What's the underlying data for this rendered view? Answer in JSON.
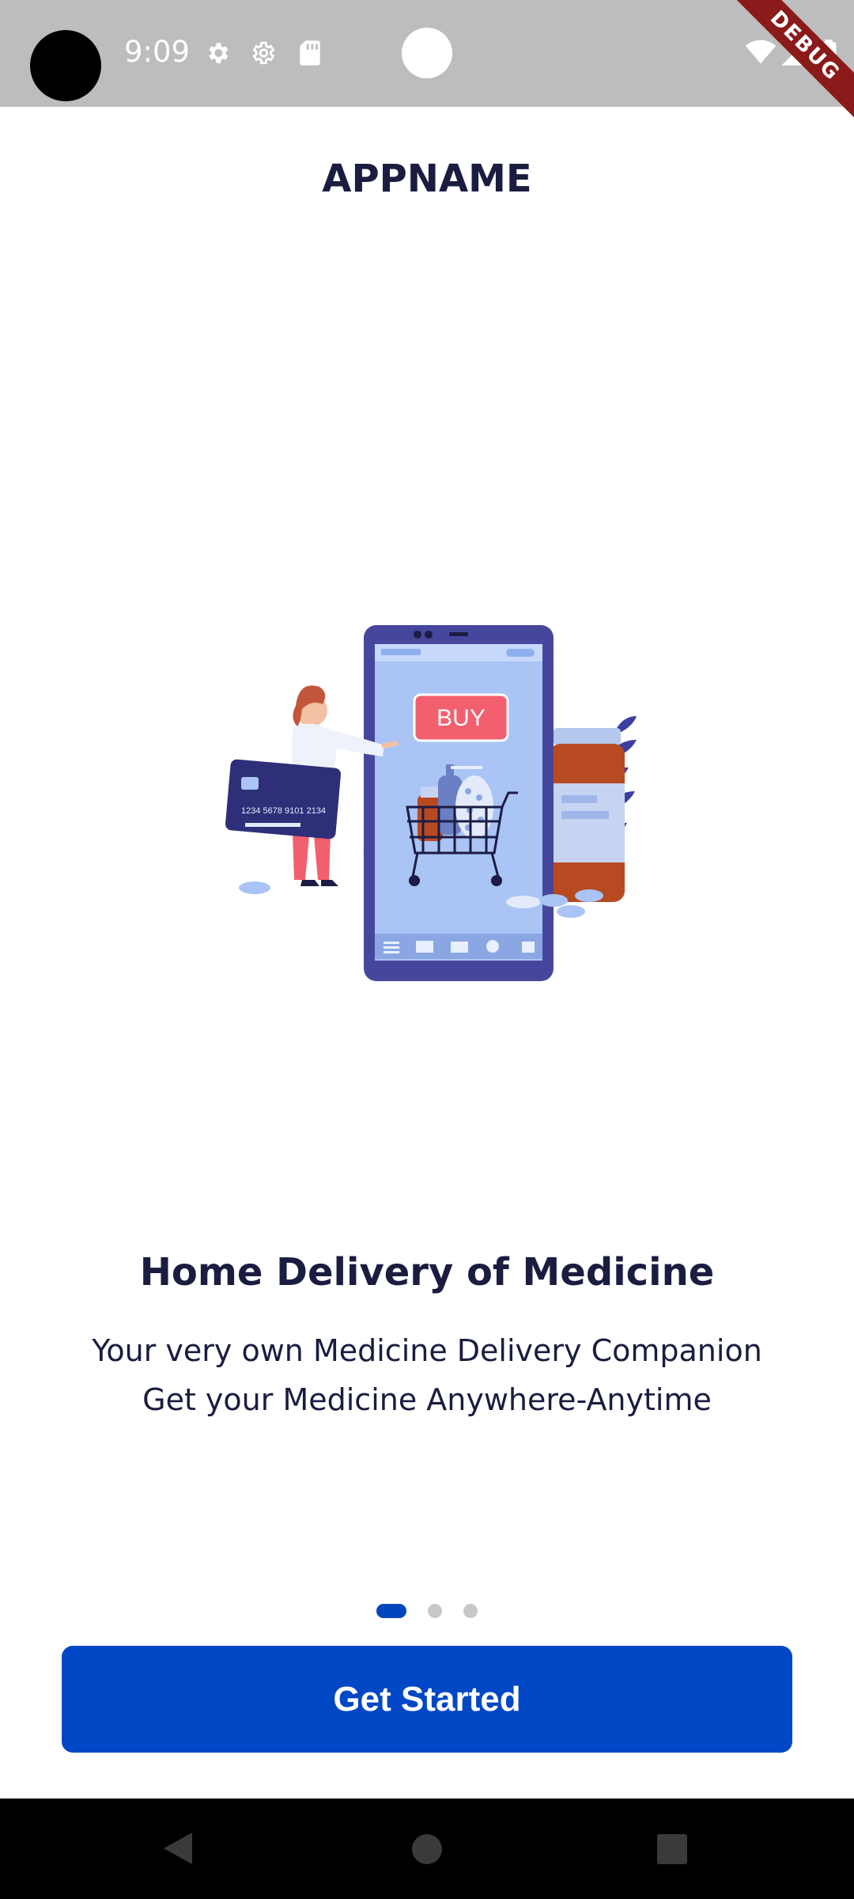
{
  "status_bar": {
    "time": "9:09",
    "icons": [
      "settings-icon",
      "settings-outline-icon",
      "sd-card-icon",
      "wifi-icon",
      "cell-signal-icon",
      "battery-icon"
    ],
    "debug_banner": "DEBUG"
  },
  "header": {
    "app_name": "APPNAME"
  },
  "illustration": {
    "buy_label": "BUY"
  },
  "onboarding": {
    "title": "Home Delivery of Medicine",
    "subtitle_line1": "Your very own Medicine Delivery Companion",
    "subtitle_line2": "Get your Medicine Anywhere-Anytime",
    "page_index": 1,
    "page_count": 3
  },
  "cta": {
    "label": "Get Started"
  },
  "nav": [
    "back-icon",
    "home-icon",
    "recents-icon"
  ],
  "colors": {
    "primary": "#0047c6",
    "text": "#1a1d40",
    "statusbar": "#bdbdbd"
  }
}
